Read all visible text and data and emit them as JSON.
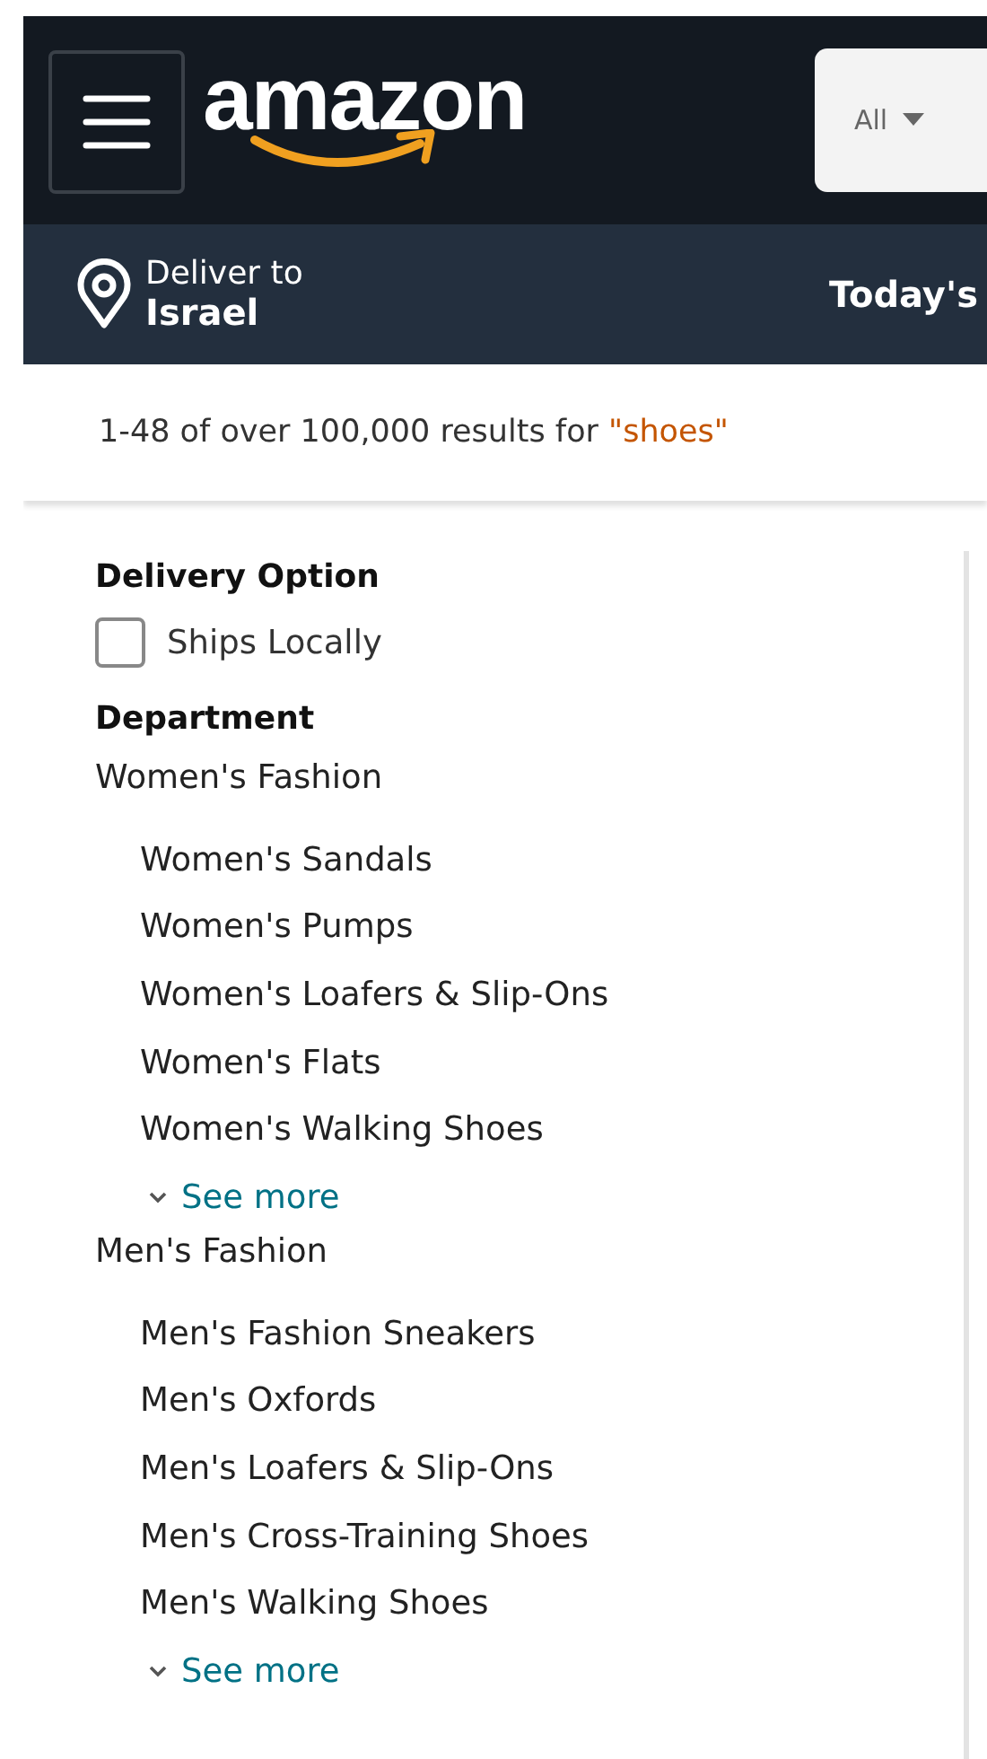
{
  "header": {
    "logo": "amazon",
    "search_scope": "All"
  },
  "subnav": {
    "deliver_label": "Deliver to",
    "deliver_location": "Israel",
    "link": "Today's"
  },
  "results": {
    "text": "1-48 of over 100,000 results for ",
    "query": "\"shoes\""
  },
  "filters": [
    {
      "kind": "checkbox",
      "title": "Delivery Option",
      "options": [
        {
          "label": "Ships Locally",
          "checked": false
        }
      ]
    },
    {
      "kind": "tree",
      "title": "Department",
      "items": [
        {
          "label": "Women's Fashion",
          "children": [
            {
              "label": "Women's Sandals"
            },
            {
              "label": "Women's Pumps"
            },
            {
              "label": "Women's Loafers & Slip-Ons"
            },
            {
              "label": "Women's Flats"
            },
            {
              "label": "Women's Walking Shoes"
            }
          ],
          "more": "See more"
        },
        {
          "label": "Men's Fashion",
          "children": [
            {
              "label": "Men's Fashion Sneakers"
            },
            {
              "label": "Men's Oxfords"
            },
            {
              "label": "Men's Loafers & Slip-Ons"
            },
            {
              "label": "Men's Cross-Training Shoes"
            },
            {
              "label": "Men's Walking Shoes"
            }
          ],
          "more": "See more"
        }
      ]
    }
  ]
}
